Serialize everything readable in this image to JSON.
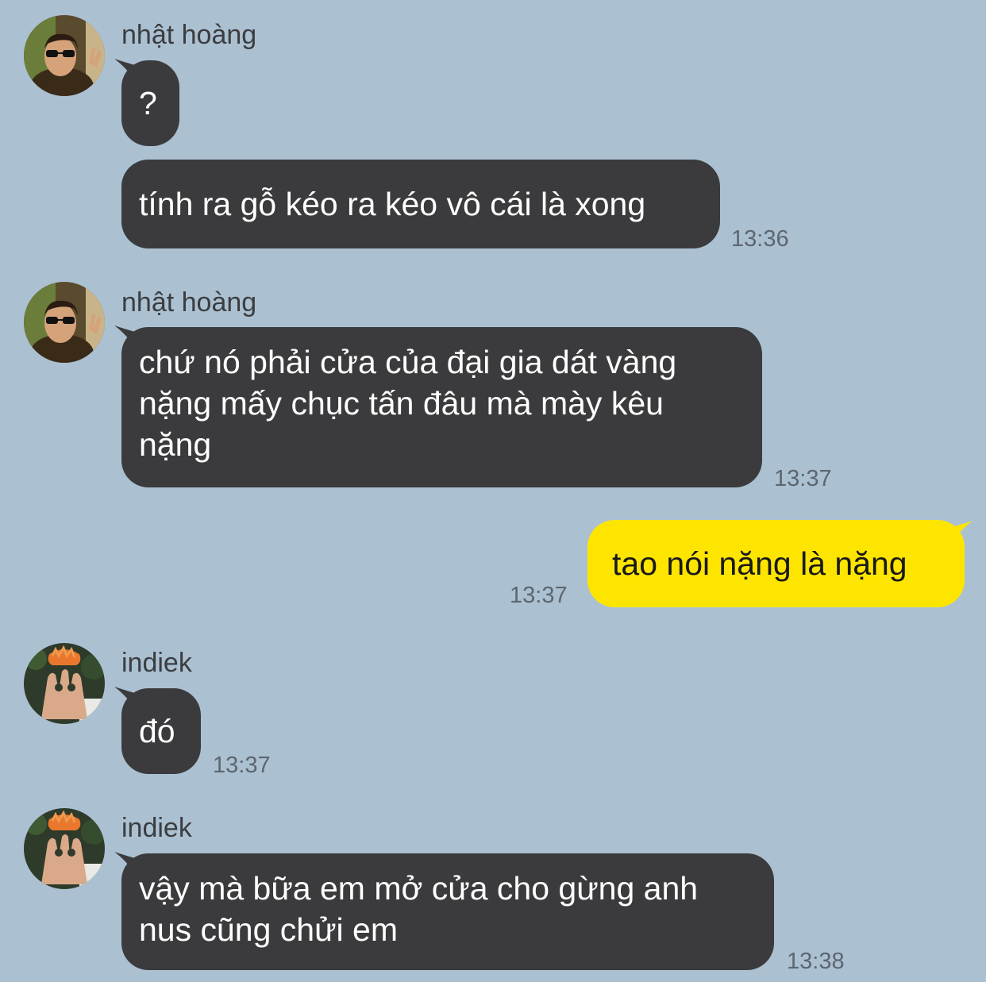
{
  "chat": {
    "colors": {
      "background": "#abc1d2",
      "incoming_bubble": "#3b3b3d",
      "outgoing_bubble": "#fee500"
    },
    "groups": [
      {
        "sender": "nhật hoàng",
        "messages": [
          {
            "text": "?",
            "time": ""
          },
          {
            "text": "tính ra gỗ kéo ra kéo vô cái là xong",
            "time": "13:36"
          }
        ]
      },
      {
        "sender": "nhật hoàng",
        "messages": [
          {
            "lines": [
              "chứ nó phải cửa của đại gia dát vàng",
              "nặng mấy chục tấn đâu mà mày kêu",
              "nặng"
            ],
            "time": "13:37"
          }
        ]
      },
      {
        "sender": "me",
        "messages": [
          {
            "text": "tao nói nặng là nặng",
            "time": "13:37"
          }
        ]
      },
      {
        "sender": "indiek",
        "messages": [
          {
            "text": "đó",
            "time": "13:37"
          }
        ]
      },
      {
        "sender": "indiek",
        "messages": [
          {
            "lines": [
              "vậy mà bữa em mở cửa cho gừng anh",
              "nus cũng chửi em"
            ],
            "time": "13:38"
          }
        ]
      }
    ]
  }
}
